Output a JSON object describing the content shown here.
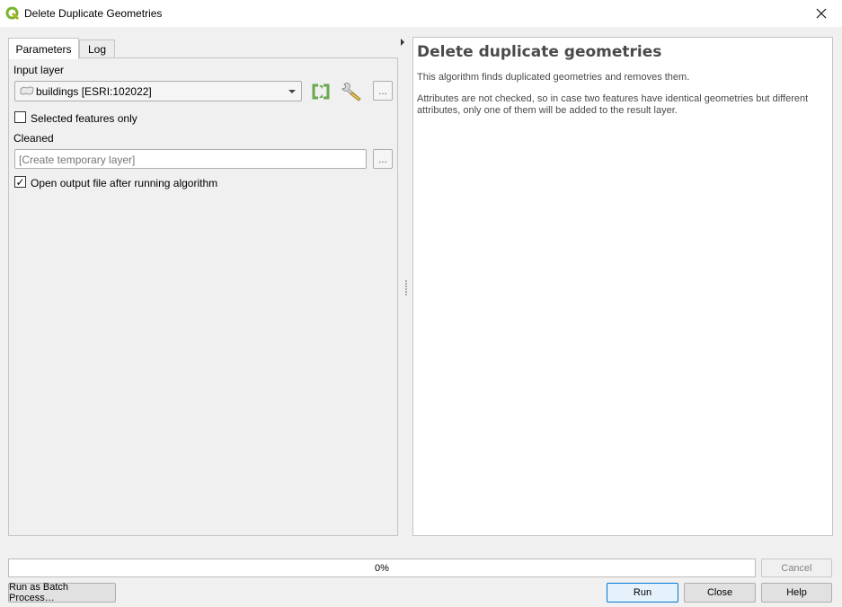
{
  "window": {
    "title": "Delete Duplicate Geometries",
    "app_icon": "qgis-logo-icon",
    "close_icon": "close-icon"
  },
  "tabs": [
    {
      "label": "Parameters",
      "active": true
    },
    {
      "label": "Log",
      "active": false
    }
  ],
  "parameters": {
    "input_layer_label": "Input layer",
    "input_layer_value": "buildings [ESRI:102022]",
    "input_layer_icon": "polygon-layer-icon",
    "iterate_icon": "iterate-refresh-icon",
    "settings_icon": "wrench-icon",
    "browse_label": "…",
    "selected_only_label": "Selected features only",
    "selected_only_checked": false,
    "cleaned_label": "Cleaned",
    "cleaned_placeholder": "[Create temporary layer]",
    "open_output_label": "Open output file after running algorithm",
    "open_output_checked": true,
    "check_mark": "✓"
  },
  "help": {
    "title": "Delete duplicate geometries",
    "paragraphs": [
      "This algorithm finds duplicated geometries and removes them.",
      "Attributes are not checked, so in case two features have identical geometries but different attributes, only one of them will be added to the result layer."
    ]
  },
  "footer": {
    "progress_percent": 0,
    "progress_text": "0%",
    "cancel_label": "Cancel",
    "batch_label": "Run as Batch Process…",
    "run_label": "Run",
    "close_label": "Close",
    "help_label": "Help"
  },
  "colors": {
    "accent_green": "#6aa84f",
    "default_button_border": "#0078d7"
  }
}
